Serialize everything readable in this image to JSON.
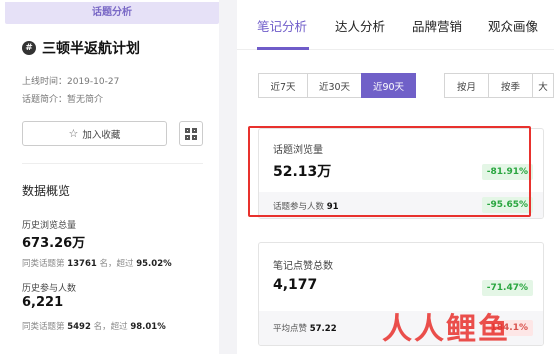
{
  "left": {
    "topic_tag": "话题分析",
    "title": "三顿半返航计划",
    "launch_time": "上线时间：2019-10-27",
    "intro": "话题简介：暂无简介",
    "fav_button": "加入收藏",
    "section_title": "数据概览",
    "stats": [
      {
        "label": "历史浏览总量",
        "value": "673.26万",
        "sub_prefix": "同类话题第",
        "rank": "13761",
        "sub_mid": "名，超过",
        "percent": "95.02%"
      },
      {
        "label": "历史参与人数",
        "value": "6,221",
        "sub_prefix": "同类话题第",
        "rank": "5492",
        "sub_mid": "名，超过",
        "percent": "98.01%"
      }
    ]
  },
  "right": {
    "tabs": [
      "笔记分析",
      "达人分析",
      "品牌营销",
      "观众画像"
    ],
    "range_buttons": [
      "近7天",
      "近30天",
      "近90天"
    ],
    "period_buttons": [
      "按月",
      "按季",
      "大"
    ],
    "cards": [
      {
        "label": "话题浏览量",
        "value": "52.13万",
        "change": "-81.91%",
        "footer_label": "话题参与人数",
        "footer_value": "91",
        "footer_change": "-95.65%"
      },
      {
        "label": "笔记点赞总数",
        "value": "4,177",
        "change": "-71.47%",
        "footer_label": "平均点赞",
        "footer_value": "57.22",
        "footer_change": "184.1%"
      }
    ]
  },
  "watermark": "人人鲤鱼",
  "colors": {
    "accent": "#6f5cc9",
    "highlight": "#e8312d",
    "positive_bg": "#e4f6e6",
    "positive_text": "#2aa640"
  }
}
